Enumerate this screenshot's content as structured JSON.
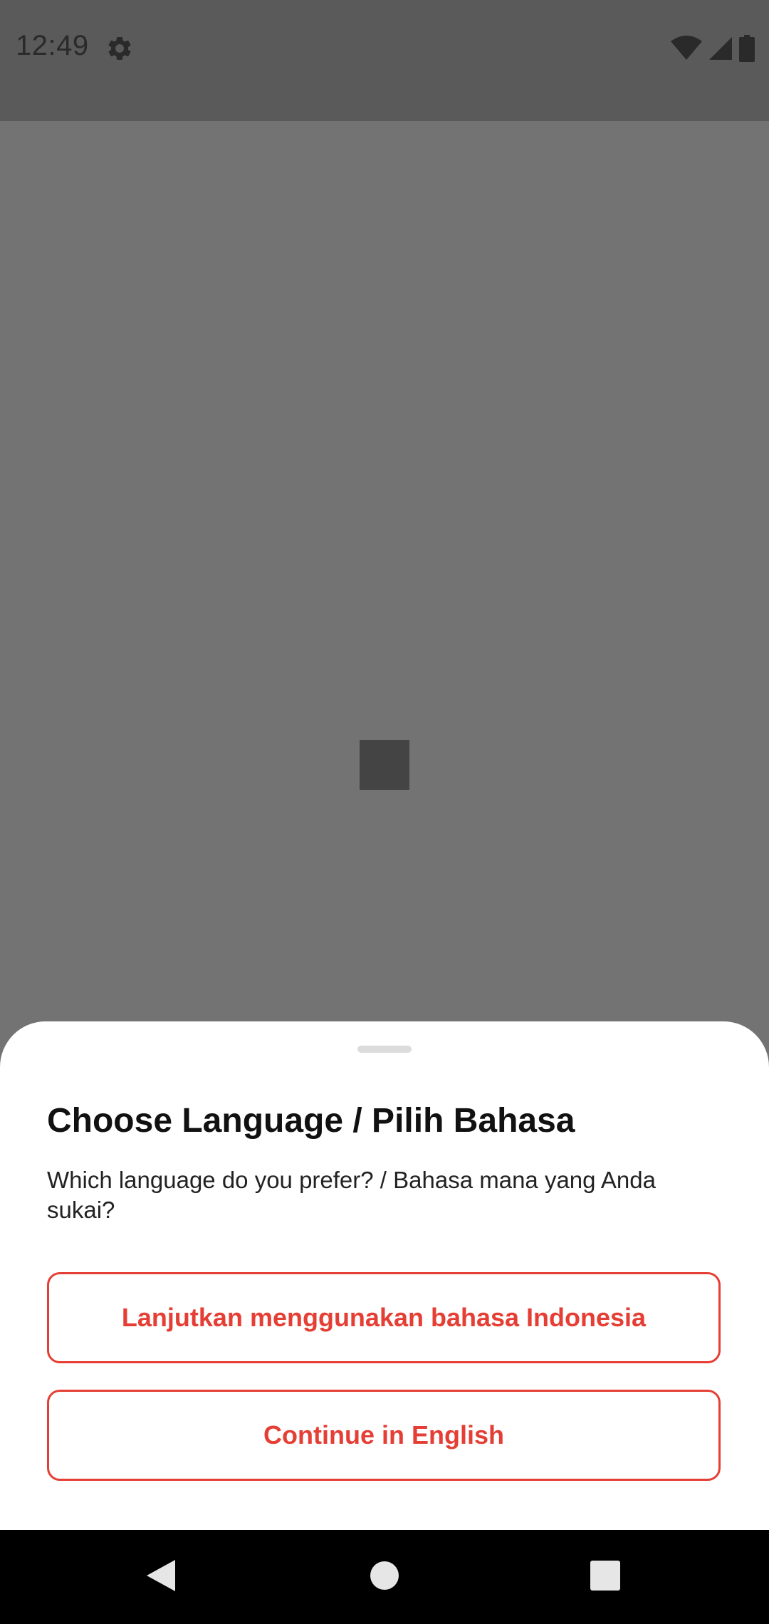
{
  "status_bar": {
    "time": "12:49",
    "icons": [
      "settings-icon",
      "wifi-icon",
      "cellular-signal-icon",
      "battery-icon"
    ]
  },
  "sheet": {
    "title": "Choose Language / Pilih Bahasa",
    "subtitle": "Which language do you prefer? / Bahasa mana yang Anda sukai?",
    "buttons": [
      {
        "id": "indonesia",
        "label": "Lanjutkan menggunakan bahasa Indonesia"
      },
      {
        "id": "english",
        "label": "Continue in English"
      }
    ]
  },
  "nav_bar": {
    "icons": [
      "back-icon",
      "home-icon",
      "recents-icon"
    ]
  },
  "colors": {
    "accent": "#e53f35",
    "scrim": "#737373",
    "status_bar": "#5a5a5a",
    "sheet_background": "#ffffff",
    "nav_bar": "#000000"
  }
}
